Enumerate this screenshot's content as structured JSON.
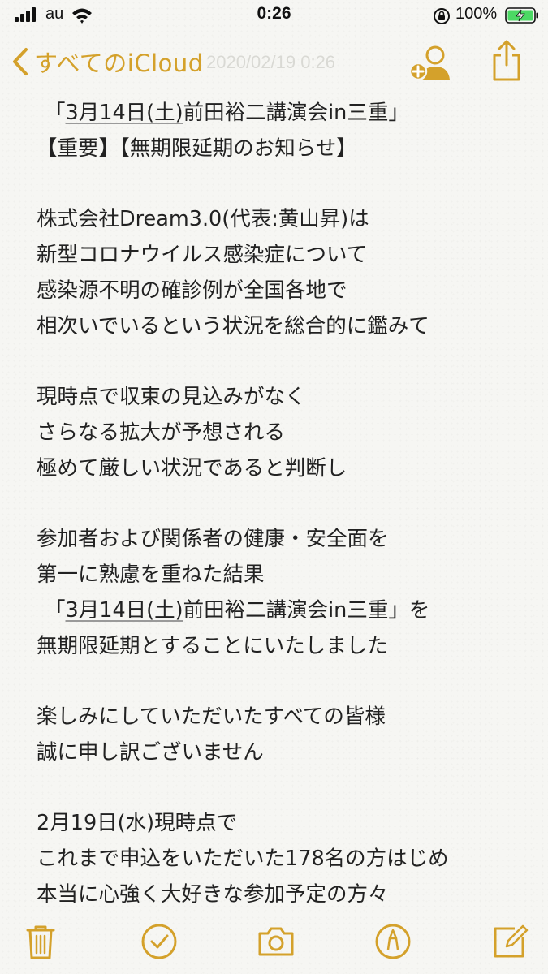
{
  "status_bar": {
    "carrier": "au",
    "time": "0:26",
    "battery_percent": "100%",
    "battery_level": 1.0,
    "signal_bars": 4,
    "icons": [
      "signal-bars-icon",
      "wifi-icon",
      "rotation-lock-icon",
      "battery-charging-icon"
    ]
  },
  "nav": {
    "back_label": "すべてのiCloud",
    "faded_header_date": "2020/02/19 0:26",
    "icons": [
      "chevron-left-icon",
      "add-person-icon",
      "share-icon"
    ]
  },
  "colors": {
    "accent": "#d4a12b",
    "text": "#222222",
    "background": "#f6f6f3"
  },
  "note": {
    "lines": [
      {
        "text": "「",
        "link": "3月14日(土)",
        "after": "前田裕二講演会in三重」"
      },
      {
        "text": "【重要】【無期限延期のお知らせ】"
      },
      {
        "text": ""
      },
      {
        "text": "株式会社Dream3.0(代表:黄山昇)は"
      },
      {
        "text": "新型コロナウイルス感染症について"
      },
      {
        "text": "感染源不明の確診例が全国各地で"
      },
      {
        "text": "相次いでいるという状況を総合的に鑑みて"
      },
      {
        "text": ""
      },
      {
        "text": "現時点で収束の見込みがなく"
      },
      {
        "text": "さらなる拡大が予想される"
      },
      {
        "text": "極めて厳しい状況であると判断し"
      },
      {
        "text": ""
      },
      {
        "text": "参加者および関係者の健康・安全面を"
      },
      {
        "text": "第一に熟慮を重ねた結果"
      },
      {
        "text": "「",
        "link": "3月14日(土)",
        "after": "前田裕二講演会in三重」を"
      },
      {
        "text": "無期限延期とすることにいたしました"
      },
      {
        "text": ""
      },
      {
        "text": "楽しみにしていただいたすべての皆様"
      },
      {
        "text": "誠に申し訳ございません"
      },
      {
        "text": ""
      },
      {
        "text": "2月19日(水)現時点で"
      },
      {
        "text": "これまで申込をいただいた178名の方はじめ"
      },
      {
        "text": "本当に心強く大好きな参加予定の方々"
      }
    ]
  },
  "toolbar": {
    "icons": [
      "trash-icon",
      "checklist-icon",
      "camera-icon",
      "markup-pen-icon",
      "compose-icon"
    ]
  }
}
